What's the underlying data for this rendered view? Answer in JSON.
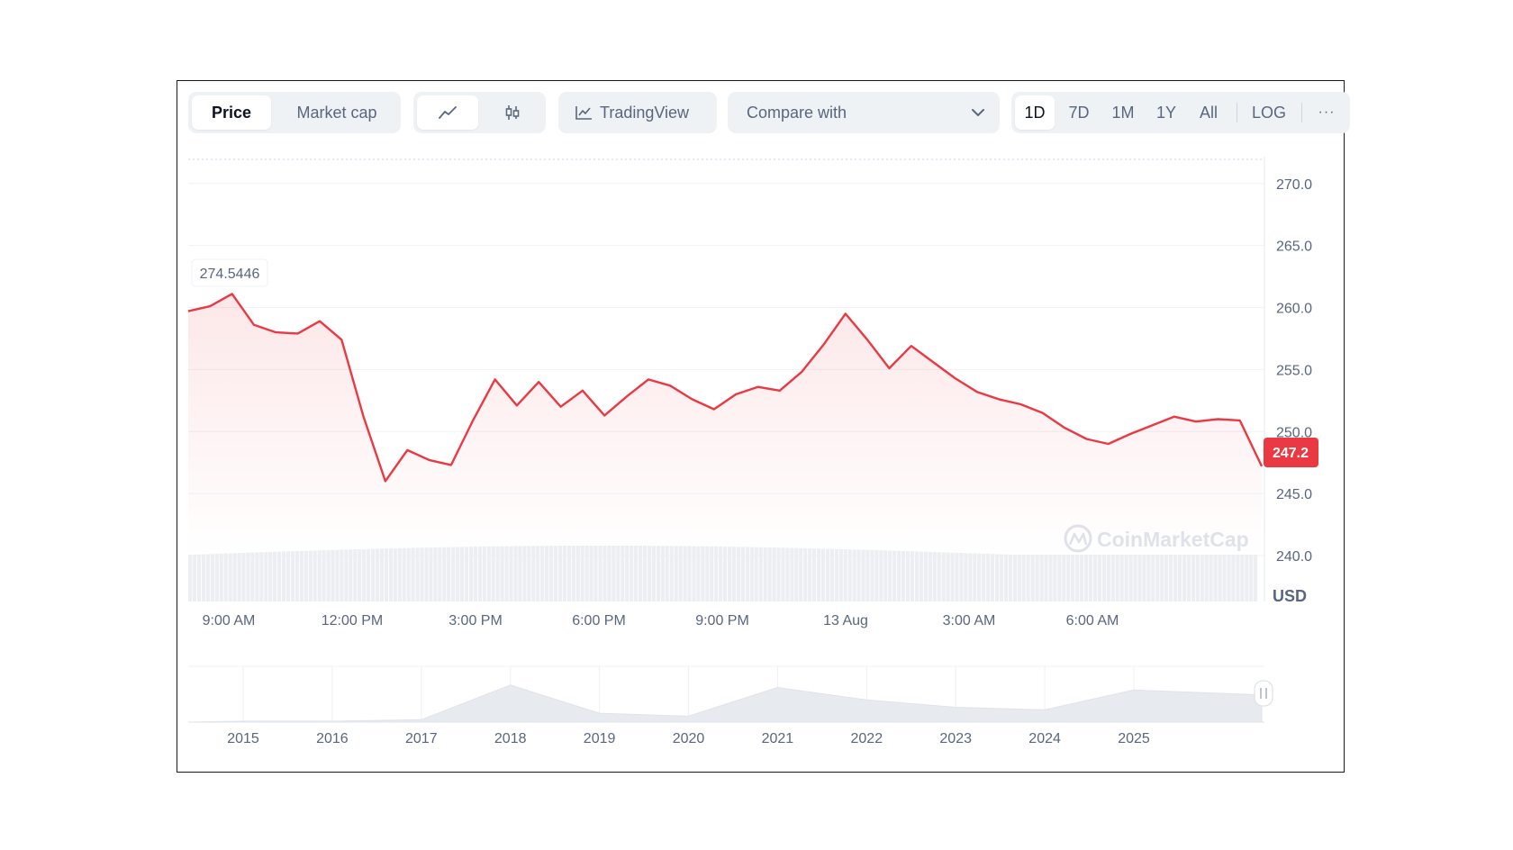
{
  "toolbar": {
    "metric_tabs": [
      "Price",
      "Market cap"
    ],
    "tradingview_label": "TradingView",
    "compare_label": "Compare with",
    "ranges": [
      "1D",
      "7D",
      "1M",
      "1Y",
      "All"
    ],
    "log_label": "LOG",
    "more_label": "···"
  },
  "chart": {
    "open_price_label": "274.5446",
    "current_price_label": "247.2",
    "currency_label": "USD",
    "watermark": "CoinMarketCap",
    "accent_color": "#ea3943",
    "grid_color": "#eff2f5"
  },
  "chart_data": [
    {
      "type": "line",
      "title": "",
      "xlabel": "",
      "ylabel": "",
      "x_tick_labels": [
        "9:00 AM",
        "12:00 PM",
        "3:00 PM",
        "6:00 PM",
        "9:00 PM",
        "13 Aug",
        "3:00 AM",
        "6:00 AM"
      ],
      "y_tick_labels": [
        "270.0",
        "265.0",
        "260.0",
        "255.0",
        "250.0",
        "245.0",
        "240.0"
      ],
      "ylim": [
        240,
        271
      ],
      "x_hours": [
        0,
        0.5,
        1,
        1.5,
        2,
        2.5,
        3,
        3.5,
        4,
        4.5,
        5,
        5.5,
        6,
        6.5,
        7,
        7.5,
        8,
        8.5,
        9,
        9.5,
        10,
        10.5,
        11,
        11.5,
        12,
        12.5,
        13,
        13.5,
        14,
        14.5,
        15,
        15.5,
        16,
        16.5,
        17,
        17.5,
        18,
        18.5,
        19,
        19.5,
        20,
        20.5,
        21,
        21.5,
        22,
        22.5,
        23,
        23.5,
        24,
        24.5
      ],
      "values": [
        259.7,
        260.1,
        261.1,
        258.6,
        258.0,
        257.9,
        258.9,
        257.4,
        251.2,
        246.0,
        248.5,
        247.7,
        247.3,
        250.9,
        254.2,
        252.1,
        254.0,
        252.0,
        253.3,
        251.3,
        252.8,
        254.2,
        253.7,
        252.6,
        251.8,
        253.0,
        253.6,
        253.3,
        254.8,
        257.0,
        259.5,
        257.4,
        255.1,
        256.9,
        255.6,
        254.3,
        253.2,
        252.6,
        252.2,
        251.5,
        250.3,
        249.4,
        249.0,
        249.8,
        250.5,
        251.2,
        250.8,
        251.0,
        250.9,
        247.2
      ],
      "series": [
        {
          "name": "",
          "values": []
        }
      ],
      "legend": "none",
      "grid": true
    },
    {
      "type": "area",
      "title": "",
      "x_tick_labels": [
        "2015",
        "2016",
        "2017",
        "2018",
        "2019",
        "2020",
        "2021",
        "2022",
        "2023",
        "2024",
        "2025"
      ],
      "description_values": [
        0.02,
        0.02,
        0.05,
        0.75,
        0.18,
        0.12,
        0.7,
        0.45,
        0.3,
        0.25,
        0.65
      ]
    }
  ]
}
